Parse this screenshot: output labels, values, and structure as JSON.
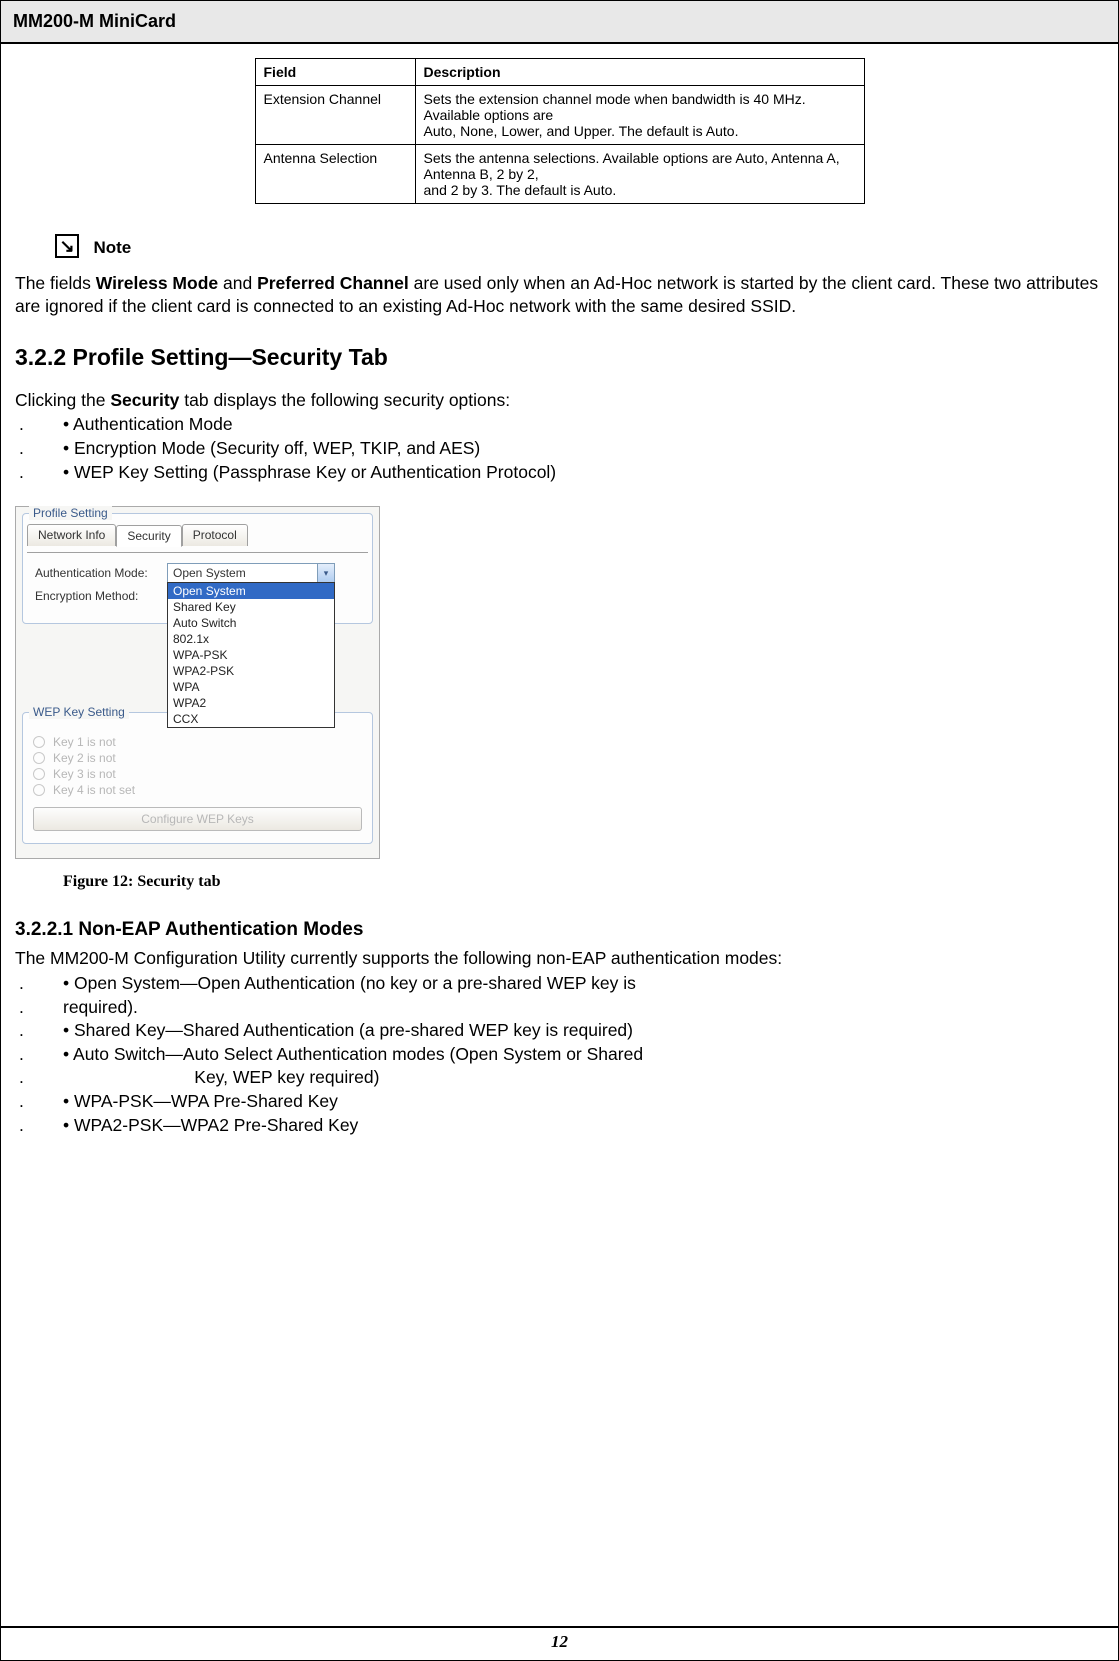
{
  "header_title": "MM200-M MiniCard",
  "table": {
    "h1": "Field",
    "h2": "Description",
    "r1c1": "Extension Channel",
    "r1c2": "Sets the extension channel mode when bandwidth is 40 MHz. Available options are\nAuto, None, Lower, and Upper. The default is Auto.",
    "r2c1": "Antenna Selection",
    "r2c2": "Sets the antenna selections. Available options are Auto, Antenna A, Antenna B, 2 by 2,\nand 2 by 3. The default is Auto."
  },
  "note": {
    "glyph": "↘",
    "label": "Note",
    "p_before": "The fields ",
    "b1": "Wireless Mode",
    "p_mid": " and ",
    "b2": "Preferred Channel",
    "p_after": " are used only when an Ad-Hoc network is started by the client card. These two attributes are ignored if the client card is connected to an existing Ad-Hoc network with the same desired SSID."
  },
  "section_title": "3.2.2 Profile Setting—Security Tab",
  "clicking_before": "Clicking the ",
  "clicking_bold": "Security",
  "clicking_after": " tab displays the following security options:",
  "sec_bullets": [
    "• Authentication Mode",
    "• Encryption Mode (Security off, WEP, TKIP, and AES)",
    "• WEP Key Setting (Passphrase Key or Authentication Protocol)"
  ],
  "screenshot": {
    "fs_title": "Profile Setting",
    "tab1": "Network Info",
    "tab2": "Security",
    "tab3": "Protocol",
    "lbl_auth": "Authentication Mode:",
    "lbl_enc": "Encryption Method:",
    "combo_value": "Open System",
    "options": [
      "Open System",
      "Shared Key",
      "Auto Switch",
      "802.1x",
      "WPA-PSK",
      "WPA2-PSK",
      "WPA",
      "WPA2",
      "CCX"
    ],
    "wep_title": "WEP Key Setting",
    "k1": "Key 1 is not",
    "k2": "Key 2 is not",
    "k3": "Key 3 is not",
    "k4": "Key 4 is not set",
    "wep_btn": "Configure WEP Keys"
  },
  "fig_caption": "Figure 12: Security tab",
  "subsection_title": "3.2.2.1 Non-EAP Authentication Modes",
  "noneap_intro": "The MM200-M Configuration Utility currently supports the following non-EAP authentication modes:",
  "noneap": [
    "• Open System—Open Authentication (no key or a pre-shared WEP key is",
    "  required).",
    "• Shared Key—Shared Authentication (a pre-shared WEP key is required)",
    "• Auto Switch—Auto Select Authentication modes (Open System or Shared",
    "                           Key, WEP key required)",
    "• WPA-PSK—WPA Pre-Shared Key",
    "• WPA2-PSK—WPA2 Pre-Shared Key"
  ],
  "page_number": "12"
}
